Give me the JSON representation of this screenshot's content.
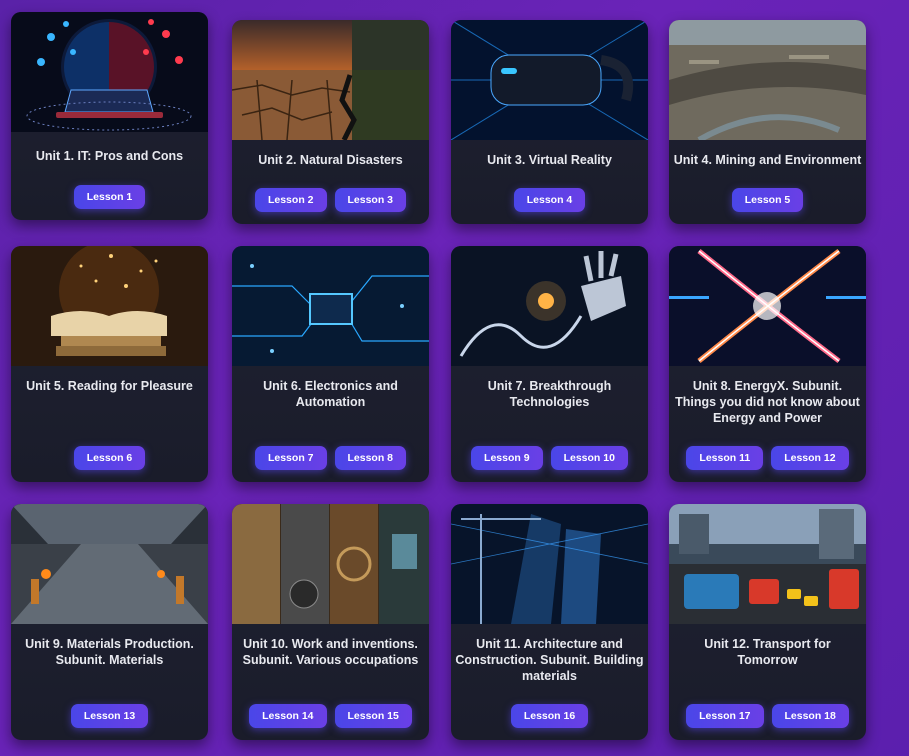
{
  "units": [
    {
      "title": "Unit 1. IT: Pros and Cons",
      "image": "laptop-network-image",
      "lessons": [
        "Lesson 1"
      ]
    },
    {
      "title": "Unit 2. Natural Disasters",
      "image": "cracked-earth-image",
      "lessons": [
        "Lesson 2",
        "Lesson 3"
      ]
    },
    {
      "title": "Unit 3. Virtual Reality",
      "image": "vr-headset-image",
      "lessons": [
        "Lesson 4"
      ]
    },
    {
      "title": "Unit 4. Mining and Environment",
      "image": "open-pit-mine-image",
      "lessons": [
        "Lesson 5"
      ]
    },
    {
      "title": "Unit 5. Reading for Pleasure",
      "image": "open-book-image",
      "lessons": [
        "Lesson 6"
      ]
    },
    {
      "title": "Unit 6. Electronics and Automation",
      "image": "circuit-board-image",
      "lessons": [
        "Lesson 7",
        "Lesson 8"
      ]
    },
    {
      "title": "Unit 7. Breakthrough Technologies",
      "image": "robot-hand-dna-image",
      "lessons": [
        "Lesson 9",
        "Lesson 10"
      ]
    },
    {
      "title": "Unit 8. EnergyX. Subunit. Things you did not know about Energy and Power",
      "image": "energy-x-image",
      "lessons": [
        "Lesson 11",
        "Lesson 12"
      ]
    },
    {
      "title": "Unit 9. Materials Production. Subunit. Materials",
      "image": "factory-image",
      "lessons": [
        "Lesson 13"
      ]
    },
    {
      "title": "Unit 10. Work and inventions. Subunit. Various occupations",
      "image": "inventions-collage-image",
      "lessons": [
        "Lesson 14",
        "Lesson 15"
      ]
    },
    {
      "title": "Unit 11. Architecture and Construction. Subunit. Building materials",
      "image": "skyscraper-construction-image",
      "lessons": [
        "Lesson 16"
      ]
    },
    {
      "title": "Unit 12. Transport for Tomorrow",
      "image": "city-traffic-image",
      "lessons": [
        "Lesson 17",
        "Lesson 18"
      ]
    }
  ],
  "colors": {
    "background": "#5d21ad",
    "card": "#1e2132",
    "button": "#4f46e5",
    "text": "#e8e9ef"
  }
}
